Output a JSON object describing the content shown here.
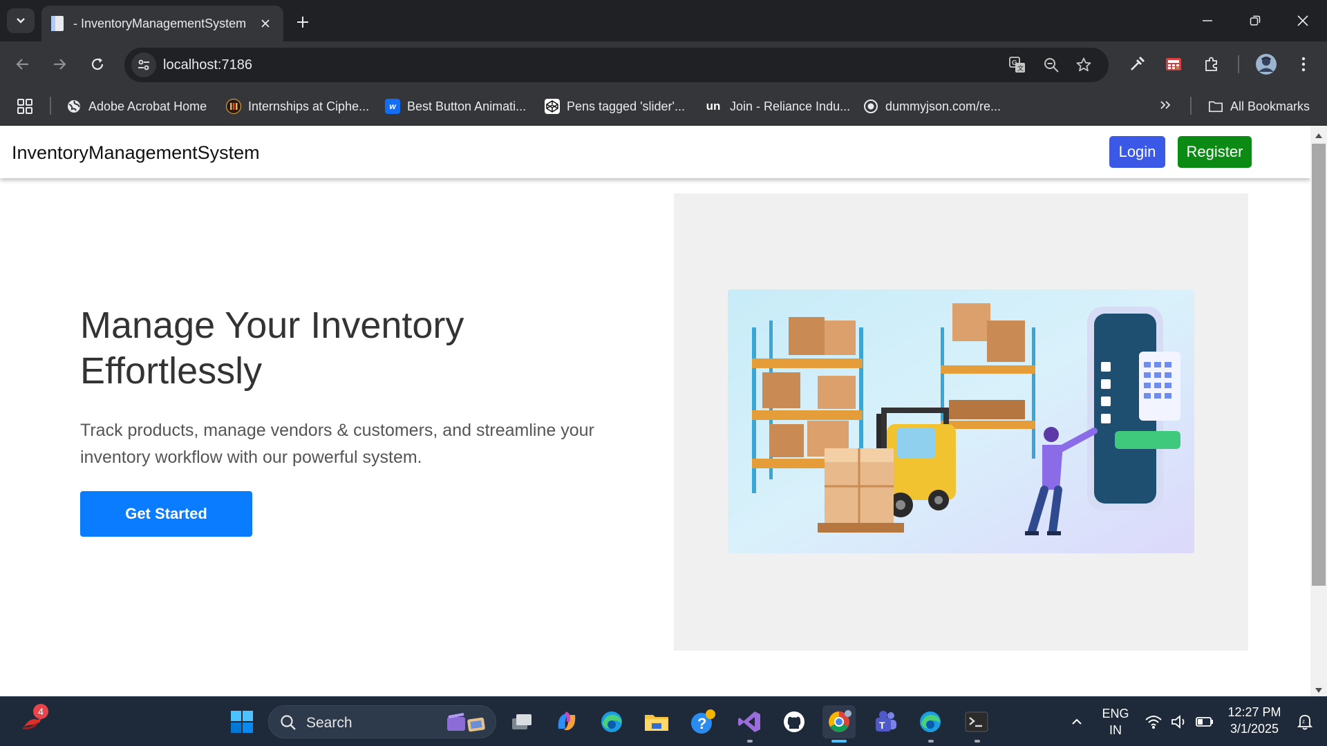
{
  "browser": {
    "tab_title": "- InventoryManagementSystem",
    "url": "localhost:7186",
    "bookmarks": [
      {
        "label": "Adobe Acrobat Home",
        "icon": "globe-icon"
      },
      {
        "label": "Internships at Ciphe...",
        "icon": "cipher-icon"
      },
      {
        "label": "Best Button Animati...",
        "icon": "webflow-icon"
      },
      {
        "label": "Pens tagged 'slider'...",
        "icon": "codepen-icon"
      },
      {
        "label": "Join - Reliance Indu...",
        "icon": "unstop-icon"
      },
      {
        "label": "dummyjson.com/re...",
        "icon": "dummyjson-icon"
      }
    ],
    "all_bookmarks_label": "All Bookmarks"
  },
  "page": {
    "brand": "InventoryManagementSystem",
    "login_label": "Login",
    "register_label": "Register",
    "hero_title": "Manage Your Inventory Effortlessly",
    "hero_subtitle": "Track products, manage vendors & customers, and streamline your inventory workflow with our powerful system.",
    "cta_label": "Get Started",
    "colors": {
      "login": "#3a59e6",
      "register": "#0b8a14",
      "cta": "#0a7cff"
    }
  },
  "taskbar": {
    "notification_count": "4",
    "search_label": "Search",
    "language": "ENG",
    "region": "IN",
    "time": "12:27 PM",
    "date": "3/1/2025"
  }
}
